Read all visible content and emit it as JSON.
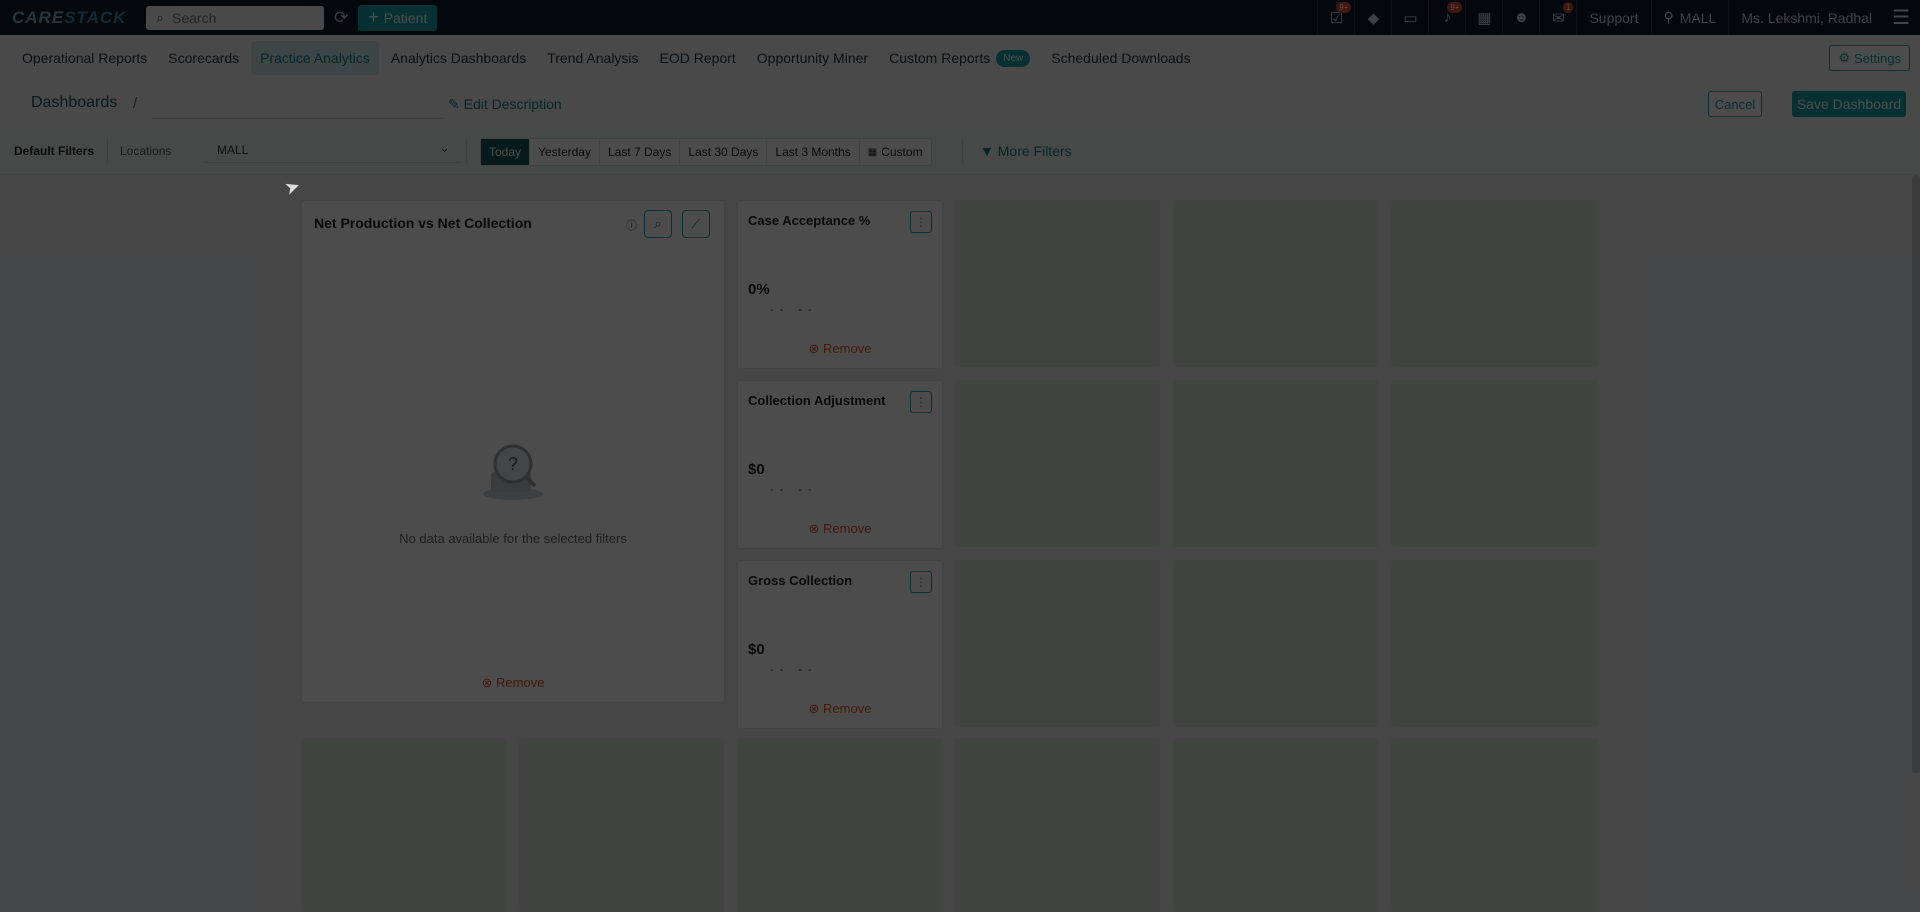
{
  "app": {
    "logo": "CARESTACK",
    "search_placeholder": "Search",
    "patient_button": "Patient",
    "support": "Support",
    "location": "MALL",
    "user": "Ms. Lekshmi, Radhal",
    "badges": {
      "tasks": "9+",
      "alerts": "9+",
      "messages": "1"
    }
  },
  "nav": {
    "items": [
      {
        "label": "Operational Reports",
        "active": false
      },
      {
        "label": "Scorecards",
        "active": false
      },
      {
        "label": "Practice Analytics",
        "active": true
      },
      {
        "label": "Analytics Dashboards",
        "active": false
      },
      {
        "label": "Trend Analysis",
        "active": false
      },
      {
        "label": "EOD Report",
        "active": false
      },
      {
        "label": "Opportunity Miner",
        "active": false
      },
      {
        "label": "Custom Reports",
        "active": false
      },
      {
        "label": "Scheduled Downloads",
        "active": false
      }
    ],
    "new_badge": "New",
    "settings": "Settings"
  },
  "dashboard": {
    "breadcrumb": "Dashboards",
    "separator": "/",
    "name_value": "",
    "edit_description": "Edit Description",
    "cancel": "Cancel",
    "save": "Save Dashboard"
  },
  "filters": {
    "default_label": "Default Filters",
    "locations_label": "Locations",
    "location_value": "MALL",
    "date_ranges": [
      "Today",
      "Yesterday",
      "Last 7 Days",
      "Last 30 Days",
      "Last 3 Months",
      "Custom"
    ],
    "active_range": "Today",
    "more_filters": "More Filters"
  },
  "widgets": {
    "net_production": {
      "title": "Net Production vs Net Collection",
      "empty_message": "No data available for the selected filters",
      "remove": "Remove"
    },
    "kpis": [
      {
        "title": "Case Acceptance %",
        "value": "0%",
        "sub": "-- --",
        "remove": "Remove"
      },
      {
        "title": "Collection Adjustment",
        "value": "$0",
        "sub": "-- --",
        "remove": "Remove"
      },
      {
        "title": "Gross Collection",
        "value": "$0",
        "sub": "-- --",
        "remove": "Remove"
      }
    ]
  },
  "colors": {
    "accent": "#17a0a8",
    "topbar": "#0b1d2e",
    "remove": "#d8592b",
    "placeholder": "#d6e6d6"
  }
}
